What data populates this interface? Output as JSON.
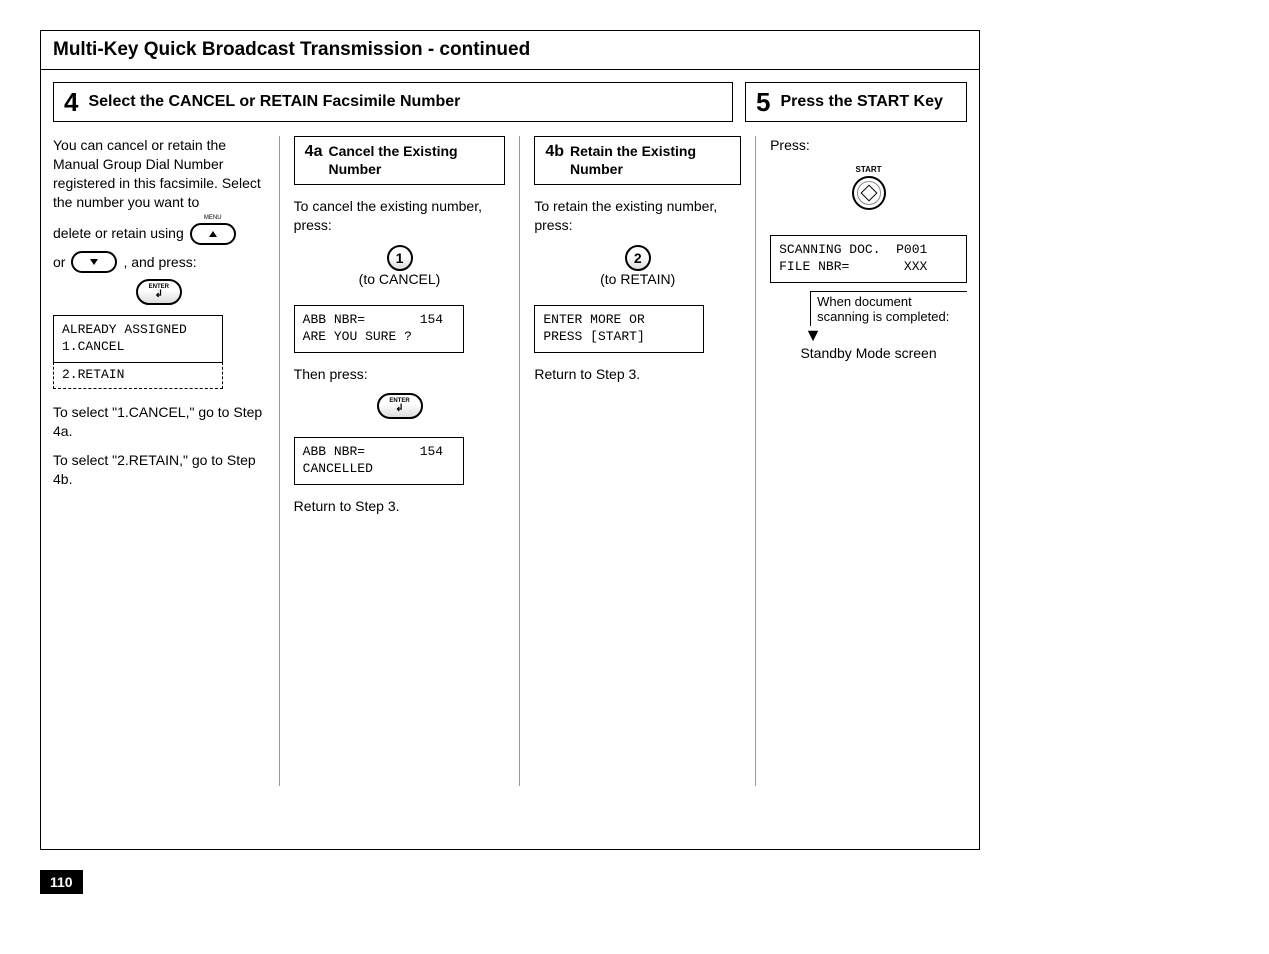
{
  "page": {
    "title": "Multi-Key Quick Broadcast Transmission - continued",
    "number": "110"
  },
  "step4": {
    "num": "4",
    "title": "Select the CANCEL or RETAIN Facsimile Number",
    "intro": {
      "p1": "You can cancel or retain the Manual Group Dial Number registered in this facsimile. Select the number you want to",
      "p2a": "delete or retain using",
      "p2b": "or",
      "p2c": ", and press:",
      "enter": "ENTER",
      "menu": "MENU",
      "display_top": "ALREADY ASSIGNED\n1.CANCEL",
      "display_bottom": "2.RETAIN",
      "p3": "To select \"1.CANCEL,\" go to Step 4a.",
      "p4": "To select \"2.RETAIN,\" go to Step 4b."
    },
    "a": {
      "num": "4a",
      "title": "Cancel the Existing Number",
      "p1": "To cancel the existing number, press:",
      "key": "1",
      "key_label": "(to CANCEL)",
      "display1": "ABB NBR=       154\nARE YOU SURE ?",
      "p2": "Then press:",
      "enter": "ENTER",
      "display2": "ABB NBR=       154\nCANCELLED",
      "p3": "Return to Step 3."
    },
    "b": {
      "num": "4b",
      "title": "Retain the Existing Number",
      "p1": "To retain the existing number, press:",
      "key": "2",
      "key_label": "(to RETAIN)",
      "display1": "ENTER MORE OR\nPRESS [START]",
      "p2": "Return to Step 3."
    }
  },
  "step5": {
    "num": "5",
    "title": "Press the START Key",
    "p1": "Press:",
    "start": "START",
    "display": "SCANNING DOC.  P001\nFILE NBR=       XXX",
    "note": "When document scanning is completed:",
    "p2": "Standby Mode screen"
  }
}
